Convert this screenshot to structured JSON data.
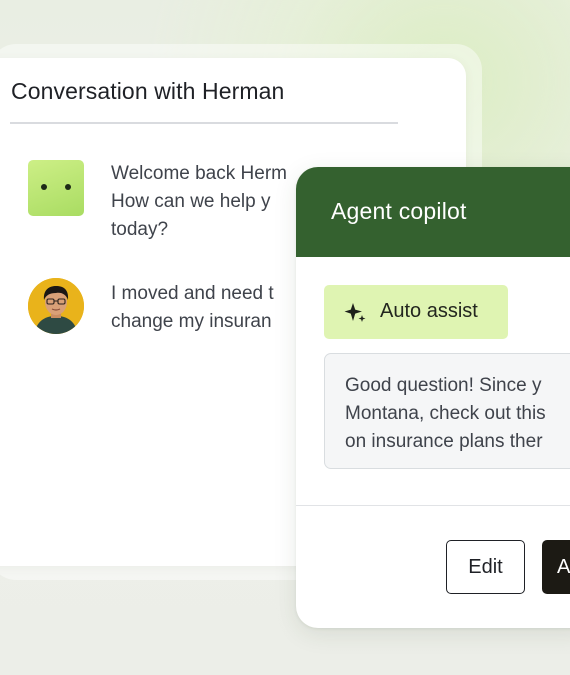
{
  "conversation": {
    "title": "Conversation with Herman",
    "messages": [
      {
        "sender": "bot",
        "lines": [
          "Welcome back Herm",
          "How can we help y",
          "today?"
        ]
      },
      {
        "sender": "user",
        "lines": [
          "I moved and need t",
          "change my insuran"
        ]
      }
    ]
  },
  "copilot": {
    "title": "Agent copilot",
    "auto_assist_label": "Auto assist",
    "suggestion_lines": [
      "Good question! Since y",
      "Montana, check out this",
      "on insurance plans ther"
    ],
    "edit_label": "Edit",
    "accept_label": "A"
  },
  "icons": {
    "bot_avatar": "bot-face-icon",
    "user_avatar": "user-photo",
    "auto_assist": "sparkle-icon"
  },
  "colors": {
    "copilot_header": "#34612f",
    "auto_assist_bg": "#dff4b2",
    "bot_avatar": "#b8e46f",
    "user_avatar_bg": "#e9b31b",
    "accept_button": "#1c1a14"
  }
}
